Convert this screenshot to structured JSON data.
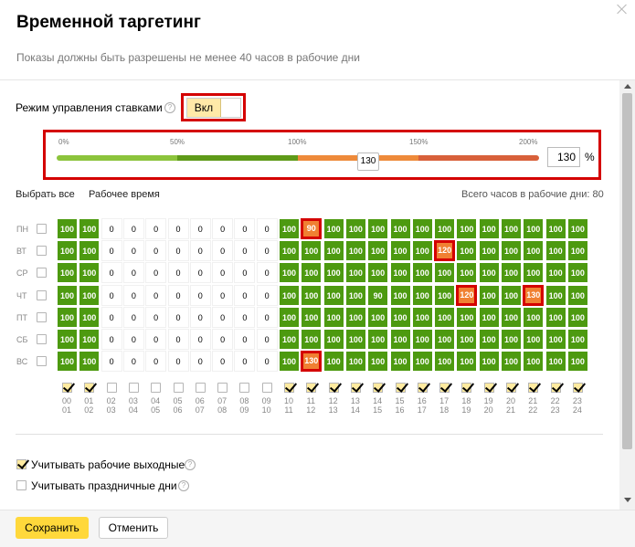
{
  "dialog": {
    "title": "Временной таргетинг",
    "subtitle": "Показы должны быть разрешены не менее 40 часов в рабочие дни"
  },
  "bid_mode": {
    "label": "Режим управления ставками",
    "toggle_value": "Вкл"
  },
  "slider": {
    "ticks": [
      "0%",
      "50%",
      "100%",
      "150%",
      "200%"
    ],
    "handle_value": "130",
    "input_value": "130",
    "unit": "%",
    "colors": {
      "green_light": "#8cc43c",
      "green_dark": "#5e9a18",
      "orange": "#ee8a3a",
      "red_orange": "#d8603a"
    }
  },
  "links": {
    "select_all": "Выбрать все",
    "work_time": "Рабочее время"
  },
  "total_hours": "Всего часов в рабочие дни: 80",
  "grid": {
    "days": [
      "ПН",
      "ВТ",
      "СР",
      "ЧТ",
      "ПТ",
      "СБ",
      "ВС"
    ],
    "rows": [
      [
        "100",
        "100",
        "0",
        "0",
        "0",
        "0",
        "0",
        "0",
        "0",
        "0",
        "100",
        "90",
        "100",
        "100",
        "100",
        "100",
        "100",
        "100",
        "100",
        "100",
        "100",
        "100",
        "100",
        "100"
      ],
      [
        "100",
        "100",
        "0",
        "0",
        "0",
        "0",
        "0",
        "0",
        "0",
        "0",
        "100",
        "100",
        "100",
        "100",
        "100",
        "100",
        "100",
        "120",
        "100",
        "100",
        "100",
        "100",
        "100",
        "100"
      ],
      [
        "100",
        "100",
        "0",
        "0",
        "0",
        "0",
        "0",
        "0",
        "0",
        "0",
        "100",
        "100",
        "100",
        "100",
        "100",
        "100",
        "100",
        "100",
        "100",
        "100",
        "100",
        "100",
        "100",
        "100"
      ],
      [
        "100",
        "100",
        "0",
        "0",
        "0",
        "0",
        "0",
        "0",
        "0",
        "0",
        "100",
        "100",
        "100",
        "100",
        "90",
        "100",
        "100",
        "100",
        "120",
        "100",
        "100",
        "130",
        "100",
        "100"
      ],
      [
        "100",
        "100",
        "0",
        "0",
        "0",
        "0",
        "0",
        "0",
        "0",
        "0",
        "100",
        "100",
        "100",
        "100",
        "100",
        "100",
        "100",
        "100",
        "100",
        "100",
        "100",
        "100",
        "100",
        "100"
      ],
      [
        "100",
        "100",
        "0",
        "0",
        "0",
        "0",
        "0",
        "0",
        "0",
        "0",
        "100",
        "100",
        "100",
        "100",
        "100",
        "100",
        "100",
        "100",
        "100",
        "100",
        "100",
        "100",
        "100",
        "100"
      ],
      [
        "100",
        "100",
        "0",
        "0",
        "0",
        "0",
        "0",
        "0",
        "0",
        "0",
        "100",
        "130",
        "100",
        "100",
        "100",
        "100",
        "100",
        "100",
        "100",
        "100",
        "100",
        "100",
        "100",
        "100"
      ]
    ],
    "highlighted": [
      [
        0,
        11
      ],
      [
        1,
        17
      ],
      [
        3,
        18
      ],
      [
        3,
        21
      ],
      [
        6,
        11
      ]
    ],
    "hour_labels": [
      [
        "00",
        "01"
      ],
      [
        "01",
        "02"
      ],
      [
        "02",
        "03"
      ],
      [
        "03",
        "04"
      ],
      [
        "04",
        "05"
      ],
      [
        "05",
        "06"
      ],
      [
        "06",
        "07"
      ],
      [
        "07",
        "08"
      ],
      [
        "08",
        "09"
      ],
      [
        "09",
        "10"
      ],
      [
        "10",
        "11"
      ],
      [
        "11",
        "12"
      ],
      [
        "12",
        "13"
      ],
      [
        "13",
        "14"
      ],
      [
        "14",
        "15"
      ],
      [
        "15",
        "16"
      ],
      [
        "16",
        "17"
      ],
      [
        "17",
        "18"
      ],
      [
        "18",
        "19"
      ],
      [
        "19",
        "20"
      ],
      [
        "20",
        "21"
      ],
      [
        "21",
        "22"
      ],
      [
        "22",
        "23"
      ],
      [
        "23",
        "24"
      ]
    ],
    "hour_checked": [
      true,
      true,
      false,
      false,
      false,
      false,
      false,
      false,
      false,
      false,
      true,
      true,
      true,
      true,
      true,
      true,
      true,
      true,
      true,
      true,
      true,
      true,
      true,
      true
    ],
    "colors": {
      "active": "#4d9a10",
      "boost": "#f08032",
      "highlight": "#d40000"
    }
  },
  "options": [
    {
      "label": "Учитывать рабочие выходные",
      "checked": true
    },
    {
      "label": "Учитывать праздничные дни",
      "checked": false
    }
  ],
  "footer": {
    "save": "Сохранить",
    "cancel": "Отменить"
  }
}
